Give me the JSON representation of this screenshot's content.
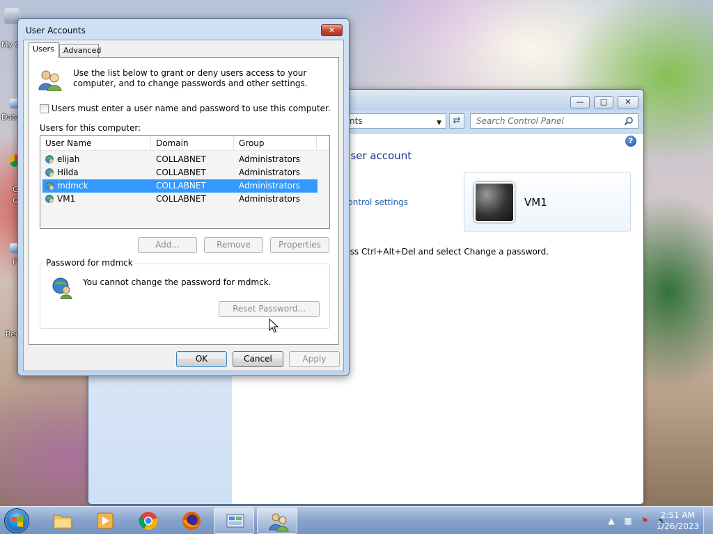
{
  "desktop": {
    "icons": [
      {
        "label": "My C"
      },
      {
        "label": "Data"
      },
      {
        "label": "G"
      },
      {
        "label": "C"
      },
      {
        "label": "F"
      },
      {
        "label": "Rec"
      }
    ]
  },
  "control_panel": {
    "address_fragment": "nts",
    "search_placeholder": "Search Control Panel",
    "heading_fragment": "r user account",
    "link_fragment": "Control settings",
    "tip_fragment": "press Ctrl+Alt+Del and select Change a password.",
    "account_name": "VM1",
    "help_glyph": "?"
  },
  "dialog": {
    "title": "User Accounts",
    "tabs": [
      {
        "label": "Users"
      },
      {
        "label": "Advanced"
      }
    ],
    "info_text": "Use the list below to grant or deny users access to your computer, and to change passwords and other settings.",
    "must_enter_checkbox": {
      "label": "Users must enter a user name and password to use this computer.",
      "checked": false
    },
    "users_label": "Users for this computer:",
    "columns": [
      "User Name",
      "Domain",
      "Group"
    ],
    "users": [
      {
        "name": "elijah",
        "domain": "COLLABNET",
        "group": "Administrators",
        "selected": false
      },
      {
        "name": "Hilda",
        "domain": "COLLABNET",
        "group": "Administrators",
        "selected": false
      },
      {
        "name": "mdmck",
        "domain": "COLLABNET",
        "group": "Administrators",
        "selected": true
      },
      {
        "name": "VM1",
        "domain": "COLLABNET",
        "group": "Administrators",
        "selected": false
      }
    ],
    "list_buttons": {
      "add": "Add...",
      "remove": "Remove",
      "properties": "Properties"
    },
    "password_group": {
      "title": "Password for mdmck",
      "message": "You cannot change the password for mdmck.",
      "reset_button": "Reset Password..."
    },
    "footer_buttons": {
      "ok": "OK",
      "cancel": "Cancel",
      "apply": "Apply"
    }
  },
  "taskbar": {
    "clock_time": "2:51 AM",
    "clock_date": "1/26/2023"
  }
}
